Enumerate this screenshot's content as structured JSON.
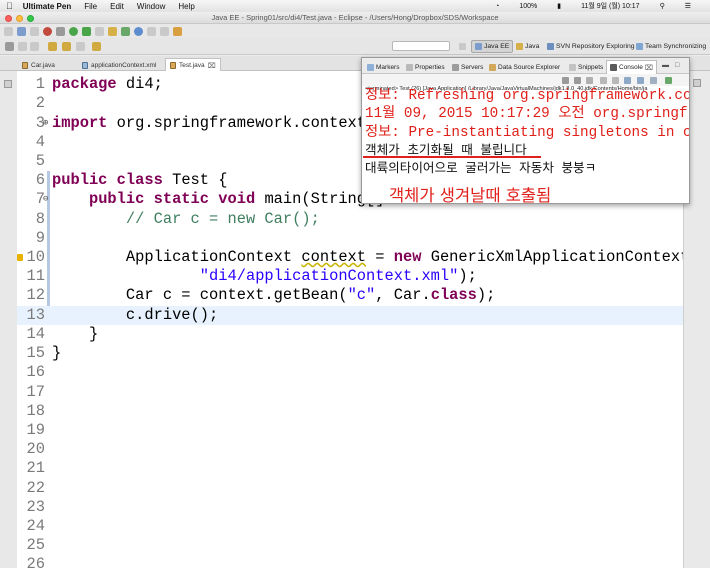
{
  "menubar": {
    "app_name": "Ultimate Pen",
    "items": [
      "File",
      "Edit",
      "Window",
      "Help"
    ],
    "battery": "100%",
    "clock": "11월 9일 (월) 10:17"
  },
  "window": {
    "title": "Java EE - Spring01/src/di4/Test.java - Eclipse - /Users/Hong/Dropbox/SDS/Workspace"
  },
  "perspectives": [
    {
      "label": "Java EE",
      "active": true
    },
    {
      "label": "Java",
      "active": false
    },
    {
      "label": "SVN Repository Exploring",
      "active": false
    },
    {
      "label": "Team Synchronizing",
      "active": false
    }
  ],
  "editor_tabs": [
    {
      "label": "Car.java",
      "active": false
    },
    {
      "label": "applicationContext.xml",
      "active": false
    },
    {
      "label": "Test.java",
      "active": true
    }
  ],
  "code_lines": [
    {
      "n": "1"
    },
    {
      "n": "2"
    },
    {
      "n": "3"
    },
    {
      "n": "4"
    },
    {
      "n": "5"
    },
    {
      "n": "6"
    },
    {
      "n": "7"
    },
    {
      "n": "8"
    },
    {
      "n": "9"
    },
    {
      "n": "10"
    },
    {
      "n": "11"
    },
    {
      "n": "12"
    },
    {
      "n": "13"
    },
    {
      "n": "14"
    },
    {
      "n": "15"
    },
    {
      "n": "16"
    },
    {
      "n": "17"
    },
    {
      "n": "18"
    },
    {
      "n": "19"
    },
    {
      "n": "20"
    },
    {
      "n": "21"
    },
    {
      "n": "22"
    },
    {
      "n": "23"
    },
    {
      "n": "24"
    },
    {
      "n": "25"
    },
    {
      "n": "26"
    }
  ],
  "code": {
    "l1_kw": "package",
    "l1_rest": " di4;",
    "l3_kw": "import",
    "l3_rest": " org.springframework.context.A",
    "l6_kw": "public class",
    "l6_rest": " Test {",
    "l7_kw": "public static void",
    "l7_rest": " main(String[]",
    "l8_comment": "// Car c = new Car();",
    "l10_a": "ApplicationContext ",
    "l10_var": "context",
    "l10_b": " = ",
    "l10_kw": "new",
    "l10_c": " GenericXmlApplicationContext(",
    "l11_str": "\"di4/applicationContext.xml\"",
    "l11_rest": ");",
    "l12_a": "Car c = context.getBean(",
    "l12_str": "\"c\"",
    "l12_b": ", Car.",
    "l12_kw": "class",
    "l12_c": ");",
    "l13": "c.drive();",
    "l14": "}",
    "l15": "}"
  },
  "console": {
    "tabs": [
      "Markers",
      "Properties",
      "Servers",
      "Data Source Explorer",
      "Snippets",
      "Console"
    ],
    "active_tab": "Console",
    "terminated": "<terminated> Test (26) [Java Application] /Library/Java/JavaVirtualMachines/jdk1.8.0_40.jdk/Contents/Home/bin/ja",
    "lines": [
      {
        "text": "정보: Refreshing org.springframework.co",
        "color": "red"
      },
      {
        "text": "11월 09, 2015 10:17:29 오전 org.springf",
        "color": "red"
      },
      {
        "text": "정보: Pre-instantiating singletons in o",
        "color": "red"
      },
      {
        "text": "객체가 초기화될 때 불립니다",
        "color": "black"
      },
      {
        "text": "대륙의타이어으로 굴러가는 자동차 붕붕ㅋ",
        "color": "black"
      }
    ]
  },
  "annotation": "객체가 생겨날때 호출됨",
  "colors": {
    "keyword": "#7f0055",
    "comment": "#3f7f5f",
    "string": "#2a00ff",
    "console_error": "#e0201a",
    "current_line": "#e8f2fe"
  }
}
